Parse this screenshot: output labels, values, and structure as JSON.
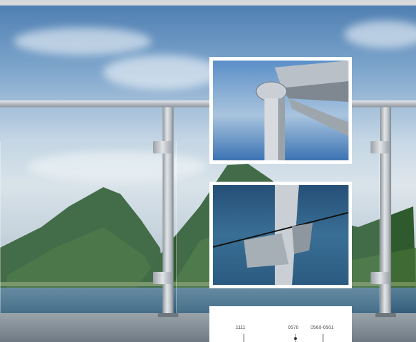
{
  "detail_card": {
    "spec_codes": [
      "1111",
      "0570",
      "0560-0561"
    ]
  }
}
